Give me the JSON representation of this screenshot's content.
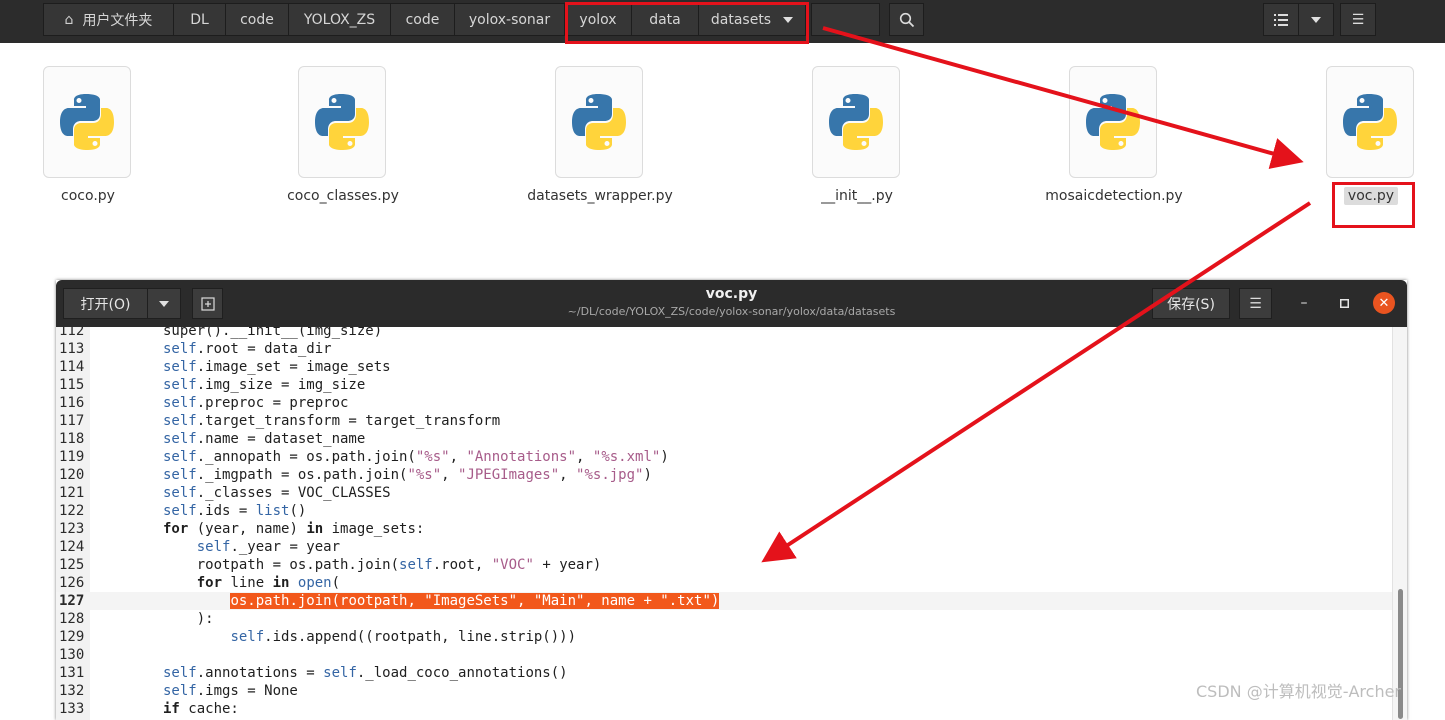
{
  "file_manager": {
    "breadcrumbs": [
      "用户文件夹",
      "DL",
      "code",
      "YOLOX_ZS",
      "code",
      "yolox-sonar",
      "yolox",
      "data",
      "datasets"
    ],
    "files": [
      {
        "name": "coco.py",
        "icon": "python-file-icon"
      },
      {
        "name": "coco_classes.py",
        "icon": "python-file-icon"
      },
      {
        "name": "datasets_wrapper.py",
        "icon": "python-file-icon"
      },
      {
        "name": "__init__.py",
        "icon": "python-file-icon"
      },
      {
        "name": "mosaicdetection.py",
        "icon": "python-file-icon"
      },
      {
        "name": "voc.py",
        "icon": "python-file-icon",
        "selected": true
      }
    ]
  },
  "editor": {
    "open_label": "打开(O)",
    "title": "voc.py",
    "path": "~/DL/code/YOLOX_ZS/code/yolox-sonar/yolox/data/datasets",
    "save_label": "保存(S)",
    "current_line": 127,
    "lines": [
      {
        "n": "112",
        "code": "super().__init__(img_size)"
      },
      {
        "n": "113",
        "code": "self.root = data_dir"
      },
      {
        "n": "114",
        "code": "self.image_set = image_sets"
      },
      {
        "n": "115",
        "code": "self.img_size = img_size"
      },
      {
        "n": "116",
        "code": "self.preproc = preproc"
      },
      {
        "n": "117",
        "code": "self.target_transform = target_transform"
      },
      {
        "n": "118",
        "code": "self.name = dataset_name"
      },
      {
        "n": "119",
        "code": "self._annopath = os.path.join(\"%s\", \"Annotations\", \"%s.xml\")"
      },
      {
        "n": "120",
        "code": "self._imgpath = os.path.join(\"%s\", \"JPEGImages\", \"%s.jpg\")"
      },
      {
        "n": "121",
        "code": "self._classes = VOC_CLASSES"
      },
      {
        "n": "122",
        "code": "self.ids = list()"
      },
      {
        "n": "123",
        "code": "for (year, name) in image_sets:"
      },
      {
        "n": "124",
        "code": "    self._year = year"
      },
      {
        "n": "125",
        "code": "    rootpath = os.path.join(self.root, \"VOC\" + year)"
      },
      {
        "n": "126",
        "code": "    for line in open("
      },
      {
        "n": "127",
        "code": "        os.path.join(rootpath, \"ImageSets\", \"Main\", name + \".txt\")"
      },
      {
        "n": "128",
        "code": "    ):"
      },
      {
        "n": "129",
        "code": "        self.ids.append((rootpath, line.strip()))"
      },
      {
        "n": "130",
        "code": ""
      },
      {
        "n": "131",
        "code": "self.annotations = self._load_coco_annotations()"
      },
      {
        "n": "132",
        "code": "self.imgs = None"
      },
      {
        "n": "133",
        "code": "if cache:"
      }
    ]
  },
  "watermark": "CSDN @计算机视觉-Archer",
  "colors": {
    "annotation_red": "#e4121b",
    "highlight_orange": "#f2581b",
    "close_orange": "#e95420"
  }
}
